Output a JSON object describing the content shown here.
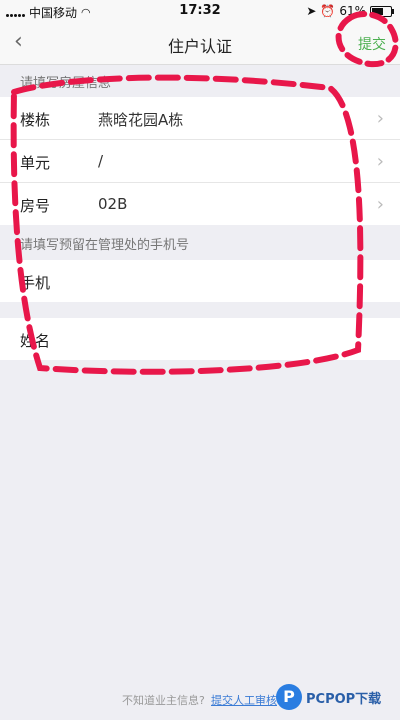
{
  "status_bar": {
    "carrier": "中国移动",
    "time": "17:32",
    "battery": "61%"
  },
  "nav": {
    "back_glyph": "‹",
    "title": "住户认证",
    "submit_label": "提交"
  },
  "house_section": {
    "label": "请填写房屋信息",
    "rows": [
      {
        "label": "楼栋",
        "value": "燕晗花园A栋"
      },
      {
        "label": "单元",
        "value": "/"
      },
      {
        "label": "房号",
        "value": "02B"
      }
    ]
  },
  "phone_section": {
    "label": "请填写预留在管理处的手机号",
    "phone_label": "手机",
    "phone_value": ""
  },
  "name_section": {
    "name_label": "姓名",
    "name_value": ""
  },
  "footer": {
    "hint": "不知道业主信息?",
    "link": "提交人工审核"
  },
  "watermark": {
    "logo_letter": "P",
    "text": "PCPOP下载"
  },
  "colors": {
    "accent_green": "#4caf50",
    "annotation_red": "#e8174a",
    "link_blue": "#3a7bd5"
  }
}
